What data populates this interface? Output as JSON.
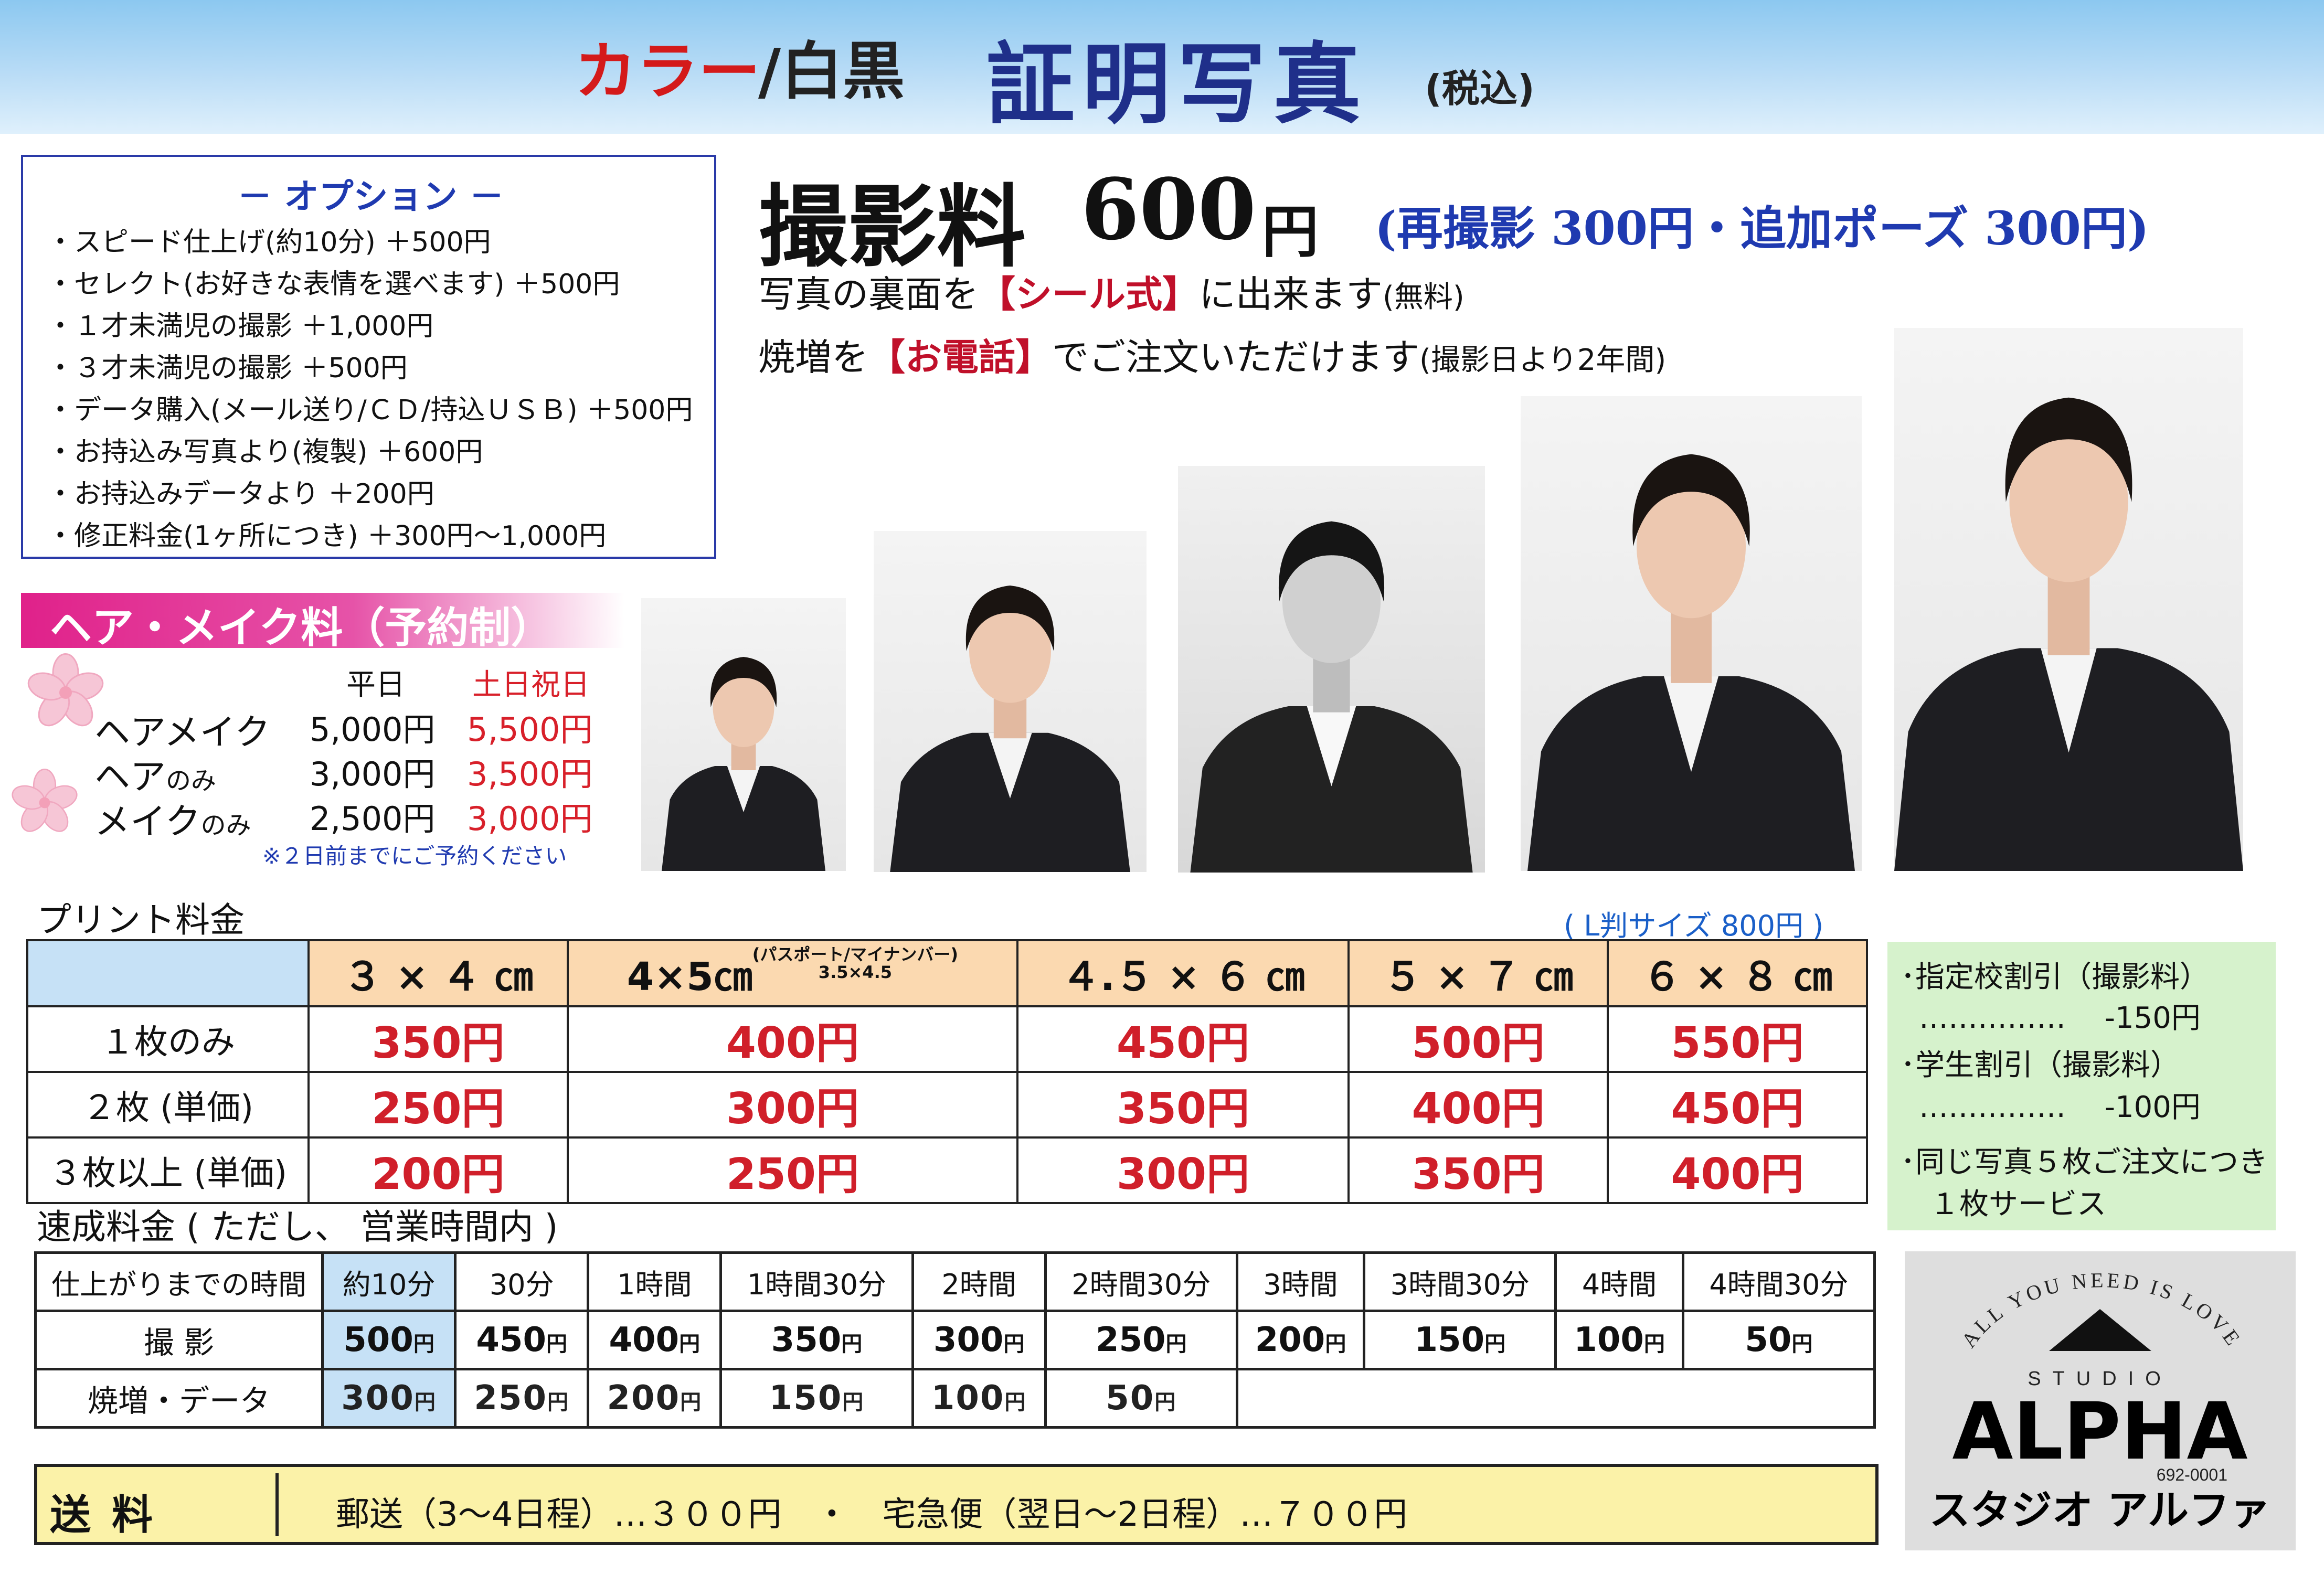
{
  "header": {
    "color_label": "カラー",
    "bw_label": "/白黒",
    "title": "証明写真",
    "tax_note": "(税込)"
  },
  "options": {
    "title": "－ オプション －",
    "items": [
      "・スピード仕上げ(約10分) ＋500円",
      "・セレクト(お好きな表情を選べます) ＋500円",
      "・１才未満児の撮影 ＋1,000円",
      "・３才未満児の撮影 ＋500円",
      "・データ購入(メール送り/ＣＤ/持込ＵＳＢ) ＋500円",
      "・お持込み写真より(複製) ＋600円",
      "・お持込みデータより ＋200円",
      "・修正料金(1ヶ所につき) ＋300円～1,000円"
    ]
  },
  "shooting": {
    "label": "撮影料",
    "value": "600",
    "yen": "円",
    "extra": "(再撮影 300円・追加ポーズ 300円)",
    "lead1_a": "写真の裏面を",
    "lead1_b": "【シール式】",
    "lead1_c": "に出来ます",
    "lead1_d": "(無料)",
    "lead2_a": "焼増を",
    "lead2_b": "【お電話】",
    "lead2_c": "でご注文いただけます",
    "lead2_d": "(撮影日より2年間)"
  },
  "hair_make": {
    "title": "ヘア・メイク料（予約制）",
    "col_weekday": "平日",
    "col_holiday": "土日祝日",
    "rows": [
      {
        "name": "ヘアメイク",
        "suffix": "",
        "weekday": "5,000円",
        "holiday": "5,500円"
      },
      {
        "name": "ヘア",
        "suffix": "のみ",
        "weekday": "3,000円",
        "holiday": "3,500円"
      },
      {
        "name": "メイク",
        "suffix": "のみ",
        "weekday": "2,500円",
        "holiday": "3,000円"
      }
    ],
    "note": "※２日前までにご予約ください"
  },
  "print": {
    "label": "プリント料金",
    "l_size": "( L判サイズ 800円 )",
    "sizes": [
      "３ × ４ ㎝",
      "4×5㎝",
      "４.５ × ６ ㎝",
      "５ × ７ ㎝",
      "６ × ８ ㎝"
    ],
    "size2_sup1": "(パスポート/マイナンバー)",
    "size2_sup2": "3.5×4.5",
    "rows": [
      {
        "label": "１枚のみ",
        "prices": [
          "350円",
          "400円",
          "450円",
          "500円",
          "550円"
        ]
      },
      {
        "label": "２枚 (単価)",
        "prices": [
          "250円",
          "300円",
          "350円",
          "400円",
          "450円"
        ]
      },
      {
        "label": "３枚以上 (単価)",
        "prices": [
          "200円",
          "250円",
          "300円",
          "350円",
          "400円"
        ]
      }
    ]
  },
  "discounts": [
    "･指定校割引（撮影料）",
    "……………　 -150円",
    "･学生割引（撮影料）",
    "……………　 -100円",
    "･同じ写真５枚ご注文につき",
    "　１枚サービス"
  ],
  "express": {
    "label": "速成料金 ( ただし、 営業時間内 )",
    "time_header": "仕上がりまでの時間",
    "times": [
      "約10分",
      "30分",
      "1時間",
      "1時間30分",
      "2時間",
      "2時間30分",
      "3時間",
      "3時間30分",
      "4時間",
      "4時間30分"
    ],
    "shoot_label": "撮 影",
    "shoot_prices": [
      "500",
      "450",
      "400",
      "350",
      "300",
      "250",
      "200",
      "150",
      "100",
      "50"
    ],
    "data_label": "焼増・データ",
    "data_prices": [
      "300",
      "250",
      "200",
      "150",
      "100",
      "50"
    ],
    "yen": "円"
  },
  "logo": {
    "arc_text": "ALL YOU NEED IS LOVE",
    "studio": "STUDIO",
    "name": "ALPHA",
    "phone": "692-0001",
    "kana": "スタジオ アルファ"
  },
  "shipping": {
    "label": "送料",
    "text": "郵送（3～4日程）…３００円　・　宅急便（翌日～2日程）…７００円"
  },
  "colors": {
    "accent_red": "#d01f2a",
    "accent_blue": "#1f3ab0",
    "pink": "#e0218a",
    "header_blue": "#8cc8f0"
  }
}
